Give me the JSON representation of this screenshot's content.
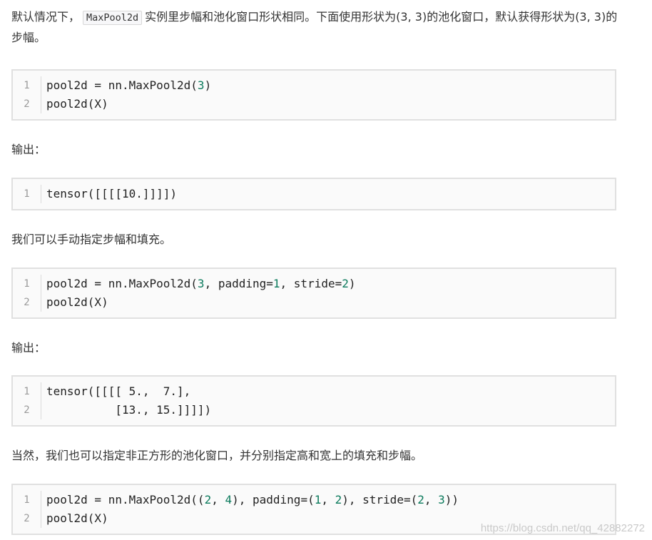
{
  "paragraphs": {
    "p1_before": "默认情况下，",
    "p1_code": "MaxPool2d",
    "p1_after": "实例里步幅和池化窗口形状相同。下面使用形状为(3, 3)的池化窗口，默认获得形状为(3, 3)的步幅。",
    "output_label_1": "输出：",
    "p_manual": "我们可以手动指定步幅和填充。",
    "output_label_2": "输出：",
    "p_nonsquare": "当然，我们也可以指定非正方形的池化窗口，并分别指定高和宽上的填充和步幅。"
  },
  "code_blocks": [
    {
      "lines": [
        {
          "n": "1",
          "parts": [
            "pool2d = nn.MaxPool2d(",
            "3",
            ")"
          ]
        },
        {
          "n": "2",
          "parts": [
            "pool2d(X)"
          ]
        }
      ]
    },
    {
      "lines": [
        {
          "n": "1",
          "parts": [
            "tensor([[[[10.]]]])"
          ]
        }
      ]
    },
    {
      "lines": [
        {
          "n": "1",
          "parts": [
            "pool2d = nn.MaxPool2d(",
            "3",
            ", padding=",
            "1",
            ", stride=",
            "2",
            ")"
          ]
        },
        {
          "n": "2",
          "parts": [
            "pool2d(X)"
          ]
        }
      ]
    },
    {
      "lines": [
        {
          "n": "1",
          "parts": [
            "tensor([[[[ 5.,  7.],"
          ]
        },
        {
          "n": "2",
          "parts": [
            "          [13., 15.]]]])"
          ]
        }
      ]
    },
    {
      "lines": [
        {
          "n": "1",
          "parts": [
            "pool2d = nn.MaxPool2d((",
            "2",
            ", ",
            "4",
            "), padding=(",
            "1",
            ", ",
            "2",
            "), stride=(",
            "2",
            ", ",
            "3",
            "))"
          ]
        },
        {
          "n": "2",
          "parts": [
            "pool2d(X)"
          ]
        }
      ]
    }
  ],
  "watermark": "https://blog.csdn.net/qq_42882272"
}
